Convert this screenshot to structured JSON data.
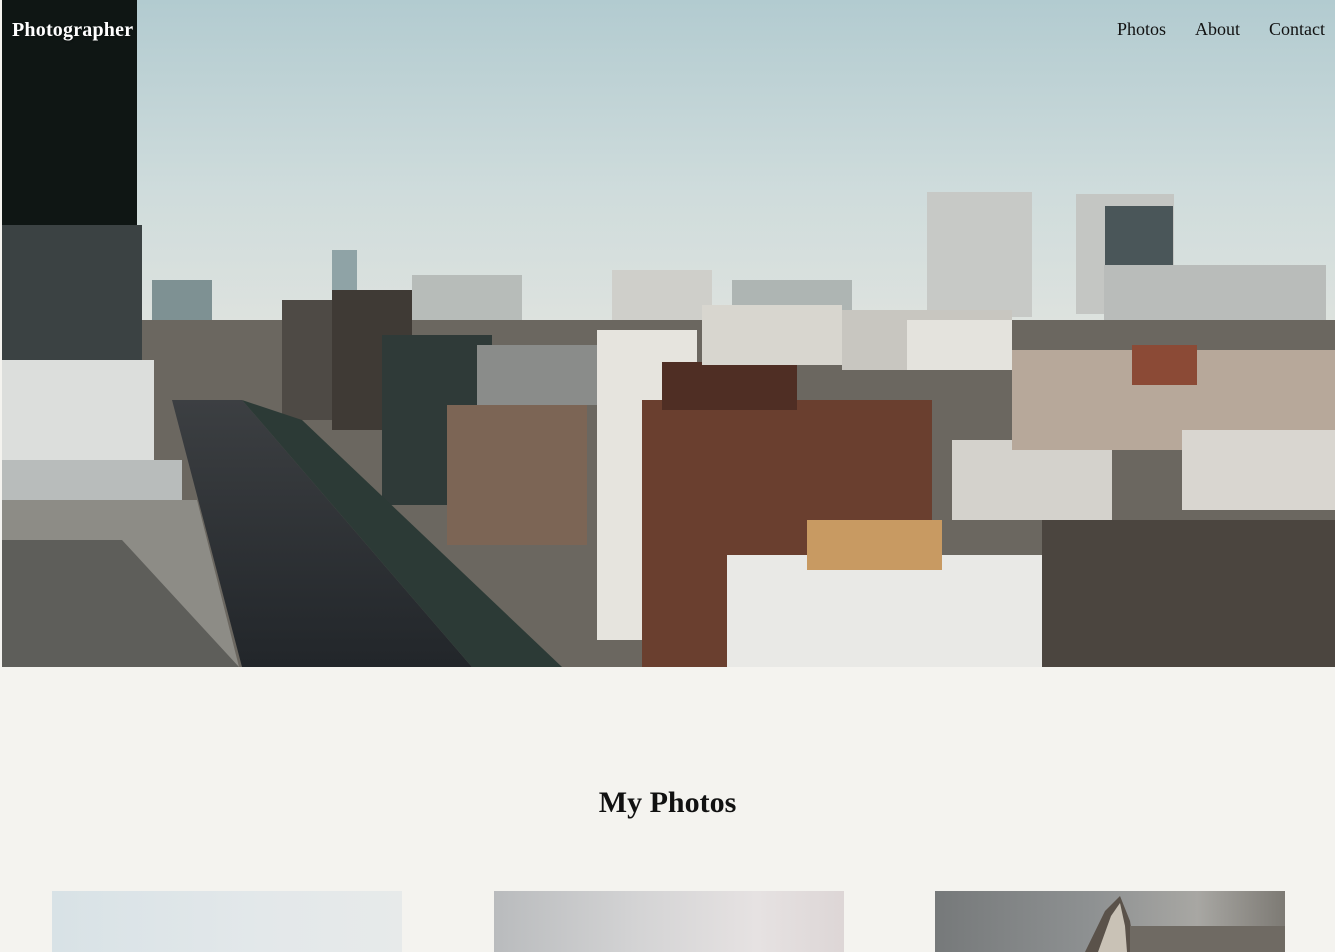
{
  "header": {
    "brand": "Photographer",
    "nav": [
      {
        "label": "Photos"
      },
      {
        "label": "About"
      },
      {
        "label": "Contact"
      }
    ]
  },
  "hero": {
    "image_description_icon": "city-skyline-photo"
  },
  "gallery": {
    "title": "My Photos",
    "photos": [
      {
        "id": "photo-1"
      },
      {
        "id": "photo-2"
      },
      {
        "id": "photo-3"
      }
    ]
  },
  "colors": {
    "page_background": "#f4f3ef",
    "brand_text": "#ffffff",
    "nav_text": "#111111"
  }
}
